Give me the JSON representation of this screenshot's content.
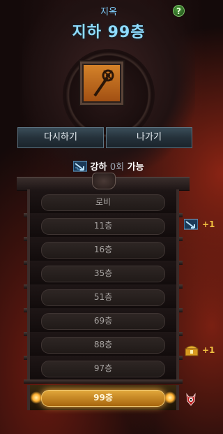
{
  "header": {
    "category": "지옥",
    "floor_title": "지하 99층",
    "help_label": "?"
  },
  "reward_item": {
    "icon": "staff-icon",
    "frame_color": "#d6842a"
  },
  "buttons": {
    "retry": "다시하기",
    "exit": "나가기"
  },
  "enhance": {
    "prefix": "강하",
    "count": "0회",
    "suffix": "가능",
    "icon": "stairs-down-icon"
  },
  "floors": [
    {
      "label": "로비",
      "active": false
    },
    {
      "label": "11층",
      "active": false
    },
    {
      "label": "16층",
      "active": false
    },
    {
      "label": "35층",
      "active": false
    },
    {
      "label": "51층",
      "active": false
    },
    {
      "label": "69층",
      "active": false
    },
    {
      "label": "88층",
      "active": false
    },
    {
      "label": "97층",
      "active": false
    },
    {
      "label": "99층",
      "active": true
    }
  ],
  "side_markers": [
    {
      "floor": "11층",
      "icon": "stairs-down-icon",
      "text": "+1"
    },
    {
      "floor": "88층",
      "icon": "treasure-chest-icon",
      "text": "+1"
    },
    {
      "floor": "99층",
      "icon": "demon-marker-icon",
      "text": ""
    }
  ],
  "colors": {
    "accent_cyan": "#8fdcff",
    "active_gold": "#e0a63a",
    "bonus_yellow": "#f0c040"
  }
}
